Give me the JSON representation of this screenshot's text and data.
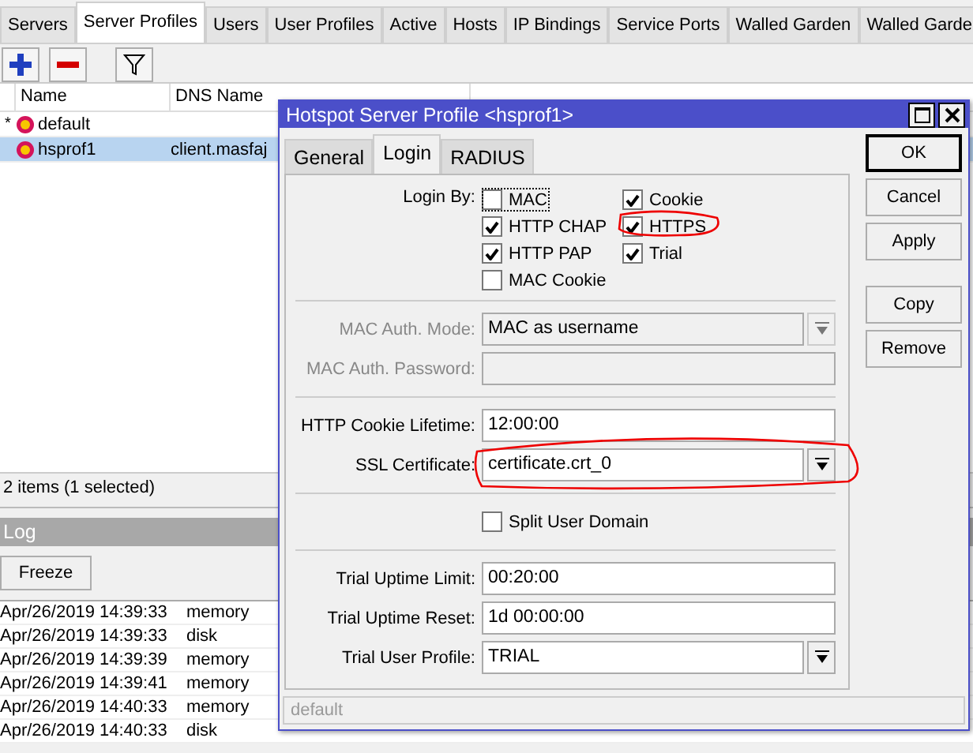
{
  "tabs": [
    {
      "label": "Servers",
      "selected": false
    },
    {
      "label": "Server Profiles",
      "selected": true
    },
    {
      "label": "Users",
      "selected": false
    },
    {
      "label": "User Profiles",
      "selected": false
    },
    {
      "label": "Active",
      "selected": false
    },
    {
      "label": "Hosts",
      "selected": false
    },
    {
      "label": "IP Bindings",
      "selected": false
    },
    {
      "label": "Service Ports",
      "selected": false
    },
    {
      "label": "Walled Garden",
      "selected": false
    },
    {
      "label": "Walled Garde",
      "selected": false
    }
  ],
  "table": {
    "columns": [
      "Name",
      "DNS Name"
    ],
    "rows": [
      {
        "marker": "*",
        "name": "default",
        "dns_name": "",
        "selected": false
      },
      {
        "marker": "",
        "name": "hsprof1",
        "dns_name": "client.masfaj",
        "selected": true
      }
    ]
  },
  "status_bar": "2 items (1 selected)",
  "log": {
    "title": "Log",
    "freeze_button": "Freeze",
    "rows": [
      {
        "time": "Apr/26/2019 14:39:33",
        "buffer": "memory"
      },
      {
        "time": "Apr/26/2019 14:39:33",
        "buffer": "disk"
      },
      {
        "time": "Apr/26/2019 14:39:39",
        "buffer": "memory"
      },
      {
        "time": "Apr/26/2019 14:39:41",
        "buffer": "memory"
      },
      {
        "time": "Apr/26/2019 14:40:33",
        "buffer": "memory"
      },
      {
        "time": "Apr/26/2019 14:40:33",
        "buffer": "disk"
      }
    ]
  },
  "dialog": {
    "title": "Hotspot Server Profile <hsprof1>",
    "tabs": [
      {
        "label": "General",
        "selected": false
      },
      {
        "label": "Login",
        "selected": true
      },
      {
        "label": "RADIUS",
        "selected": false
      }
    ],
    "login_by_label": "Login By:",
    "login_by": [
      {
        "label": "MAC",
        "checked": false,
        "focused": true
      },
      {
        "label": "Cookie",
        "checked": true,
        "focused": false
      },
      {
        "label": "HTTP CHAP",
        "checked": true,
        "focused": false
      },
      {
        "label": "HTTPS",
        "checked": true,
        "focused": false,
        "annotated": true
      },
      {
        "label": "HTTP PAP",
        "checked": true,
        "focused": false
      },
      {
        "label": "Trial",
        "checked": true,
        "focused": false
      },
      {
        "label": "MAC Cookie",
        "checked": false,
        "focused": false
      }
    ],
    "sections": [
      [
        {
          "kind": "select",
          "label": "MAC Auth. Mode:",
          "value": "MAC as username",
          "disabled": true
        },
        {
          "kind": "text",
          "label": "MAC Auth. Password:",
          "disabled": true
        }
      ],
      [
        {
          "kind": "text",
          "label": "HTTP Cookie Lifetime:",
          "value": "12:00:00",
          "disabled": false
        },
        {
          "kind": "select",
          "label": "SSL Certificate:",
          "value": "certificate.crt_0",
          "disabled": false,
          "annotated": true
        }
      ],
      [
        {
          "kind": "checkbox",
          "label": "Split User Domain",
          "checked": false
        }
      ],
      [
        {
          "kind": "text",
          "label": "Trial Uptime Limit:",
          "value": "00:20:00",
          "disabled": false
        },
        {
          "kind": "text",
          "label": "Trial Uptime Reset:",
          "value": "1d 00:00:00",
          "disabled": false
        },
        {
          "kind": "select",
          "label": "Trial User Profile:",
          "value": "TRIAL",
          "disabled": false
        }
      ]
    ],
    "buttons": [
      [
        "OK",
        "Cancel",
        "Apply"
      ],
      [
        "Copy",
        "Remove"
      ]
    ],
    "status": "default"
  }
}
